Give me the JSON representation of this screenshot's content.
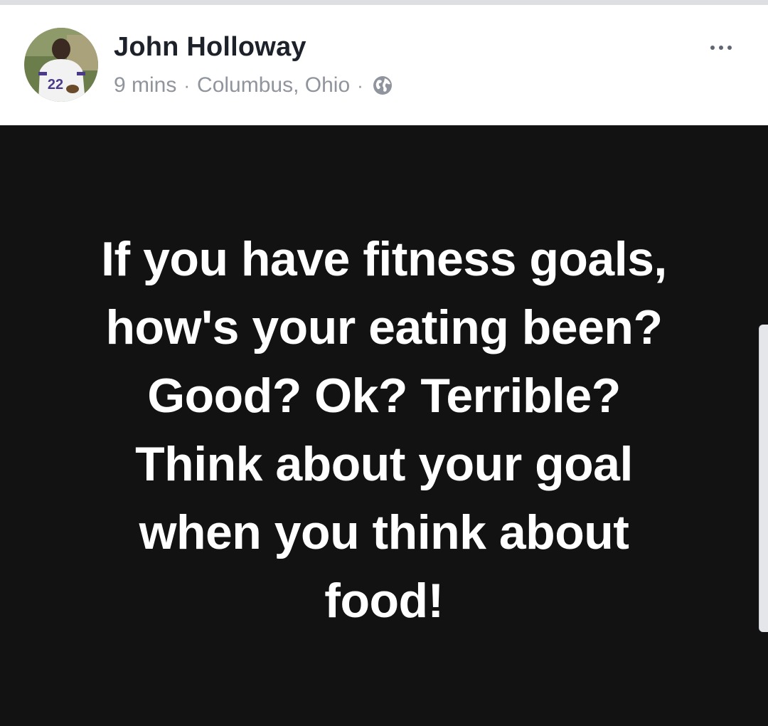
{
  "post": {
    "author": "John Holloway",
    "time": "9 mins",
    "location": "Columbus, Ohio",
    "separator": "·",
    "privacy_icon": "globe-icon",
    "more_icon": "more-options-icon",
    "avatar_jersey_number": "22",
    "text_lines": [
      "If you have fitness goals,",
      "how's your eating been?",
      "Good? Ok? Terrible?",
      "Think about your goal",
      "when you think about",
      "food!"
    ]
  },
  "colors": {
    "post_background": "#121212",
    "post_text": "#ffffff",
    "author_text": "#1d2129",
    "meta_text": "#90949c"
  }
}
